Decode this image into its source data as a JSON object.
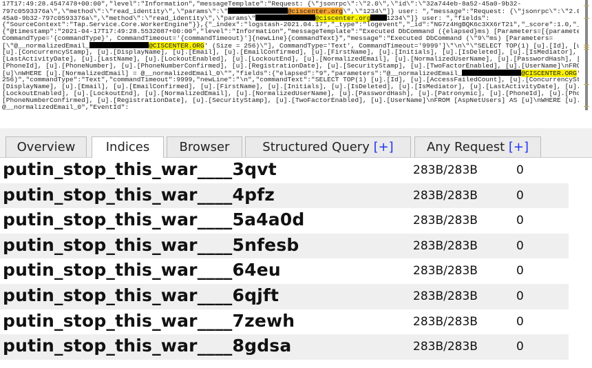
{
  "log_lines": [
    [
      {
        "t": "17T17:49:28.4547478+00:00\",\"level\":\"Information\",\"messageTemplate\":\"Request: {\\\"jsonrpc\\\":\\\"2.0\\\",\\\"id\\\":\\\"32a744eb-8a52-45a0-9b32-"
      }
    ],
    [
      {
        "t": "797c0593376a\\\",\\\"method\\\":\\\"read_identity\\\",\\\"params\\\":\\\""
      },
      {
        "redacted": true,
        "w": 15
      },
      {
        "t": "@ciscenter.org",
        "hl": "orange"
      },
      {
        "t": "\\\",\\\"1234\\\"]} user: \",\"message\":\"Request: {\\\"jsonrpc\\\":\\\"2.0\\\",\\\"id\\\":\\\"32a744eb-8a52-"
      }
    ],
    [
      {
        "t": "45a0-9b32-797c0593376a\\\",\\\"method\\\":\\\"read_identity\\\",\\\"params\\\""
      },
      {
        "redacted": true,
        "w": 15
      },
      {
        "t": "@ciscenter.org",
        "hl": "yellow"
      },
      {
        "redacted": true,
        "w": 4
      },
      {
        "t": "1234\\\"]} user: \",\"fields\":"
      }
    ],
    [
      {
        "t": "{\"SourceContext\":\"Tap.Service.Core.WorkerEngine\"}},{\"_index\":\"logstash-2021.04.17\",\"_type\":\"logevent\",\"_id\":\"NG7z4HgBQK6c3XX6rT21\",\"_score\":1.0,\"_source\":"
      }
    ],
    [
      {
        "t": "{\"@timestamp\":\"2021-04-17T17:49:28.5532087+00:00\",\"level\":\"Information\",\"messageTemplate\":\"Executed DbCommand ({elapsed}ms) [Parameters=[{parameters}],"
      }
    ],
    [
      {
        "t": "CommandType='{commandType}', CommandTimeout='{commandTimeout}']{newLine}{commandText}\",\"message\":\"Executed DbCommand (\\\"9\\\"ms) [Parameters="
      }
    ],
    [
      {
        "t": "[\\\"@__normalizedEmail_"
      },
      {
        "redacted": true,
        "w": 15
      },
      {
        "t": "@CISCENTER.ORG",
        "hl": "yellow"
      },
      {
        "t": "' (Size = 256)\\\"], CommandType='Text', CommandTimeout='9999']\\\"\\n\\\"\\\"SELECT TOP(1) [u].[Id], [u].[Access"
      },
      {
        "redacted": true,
        "w": 15
      }
    ],
    [
      {
        "t": "[u].[ConcurrencyStamp], [u].[DisplayName], [u].[Email], [u].[EmailConfirmed], [u].[FirstName], [u].[Initials], [u].[IsDeleted], [u].[IsMediator], [u]."
      }
    ],
    [
      {
        "t": "[LastActivityDate], [u].[LastName], [u].[LockoutEnabled], [u].[LockoutEnd], [u].[NormalizedEmail], [u].[NormalizedUserName], [u].[PasswordHash], [u].[Patronymic], [u]."
      }
    ],
    [
      {
        "t": "[PhoneId], [u].[PhoneNumber], [u].[PhoneNumberConfirmed], [u].[RegistrationDate], [u].[SecurityStamp], [u].[TwoFactorEnabled], [u].[UserName]\\nFROM [AspNetUsers] AS"
      }
    ],
    [
      {
        "t": "[u]\\nWHERE [u].[NormalizedEmail] = @__normalizedEmail_0\\\"\",\"fields\":{\"elapsed\":\"9\",\"parameters\":\"@__normalizedEmail_"
      },
      {
        "redacted": true,
        "w": 15
      },
      {
        "t": "@CISCENTER.ORG",
        "hl": "yellow"
      },
      {
        "t": "' (Size ="
      }
    ],
    [
      {
        "t": "256)\",\"commandType\":\"Text\",\"commandTimeout\":9999,\"newLine\":\"\\n\",\"commandText\":\"SELECT TOP(1) [u].[Id], [u].[AccessFailedCount], [u].[ConcurrencyStamp], [u]."
      }
    ],
    [
      {
        "t": "[DisplayName], [u].[Email], [u].[EmailConfirmed], [u].[FirstName], [u].[Initials], [u].[IsDeleted], [u].[IsMediator], [u].[LastActivityDate], [u].[LastName], [u]."
      }
    ],
    [
      {
        "t": "[LockoutEnabled], [u].[LockoutEnd], [u].[NormalizedEmail], [u].[NormalizedUserName], [u].[PasswordHash], [u].[Patronymic], [u].[PhoneId], [u].[PhoneNumber], [u]."
      }
    ],
    [
      {
        "t": "[PhoneNumberConfirmed], [u].[RegistrationDate], [u].[SecurityStamp], [u].[TwoFactorEnabled], [u].[UserName]\\nFROM [AspNetUsers] AS [u]\\nWHERE [u].[NormalizedEmail] ="
      }
    ],
    [
      {
        "t": "@__normalizedEmail_0\",\"EventId\":"
      }
    ]
  ],
  "tabs": [
    {
      "label": "Overview",
      "plus": ""
    },
    {
      "label": "Indices",
      "plus": "",
      "active": true
    },
    {
      "label": "Browser",
      "plus": ""
    },
    {
      "label": "Structured Query ",
      "plus": "[+]"
    },
    {
      "label": "Any Request ",
      "plus": "[+]"
    }
  ],
  "indices": [
    {
      "name": "putin_stop_this_war____3qvt",
      "size": "283B/283B",
      "docs": "0"
    },
    {
      "name": "putin_stop_this_war____4pfz",
      "size": "283B/283B",
      "docs": "0"
    },
    {
      "name": "putin_stop_this_war____5a4a0d",
      "size": "283B/283B",
      "docs": "0"
    },
    {
      "name": "putin_stop_this_war____5nfesb",
      "size": "283B/283B",
      "docs": "0"
    },
    {
      "name": "putin_stop_this_war____64eu",
      "size": "283B/283B",
      "docs": "0"
    },
    {
      "name": "putin_stop_this_war____6qjft",
      "size": "283B/283B",
      "docs": "0"
    },
    {
      "name": "putin_stop_this_war____7zewh",
      "size": "283B/283B",
      "docs": "0"
    },
    {
      "name": "putin_stop_this_war____8gdsa",
      "size": "283B/283B",
      "docs": "0"
    }
  ],
  "colors": {
    "highlight_orange": "#f5a030",
    "highlight_yellow": "#f8f000",
    "tab_plus": "#2233ee"
  }
}
